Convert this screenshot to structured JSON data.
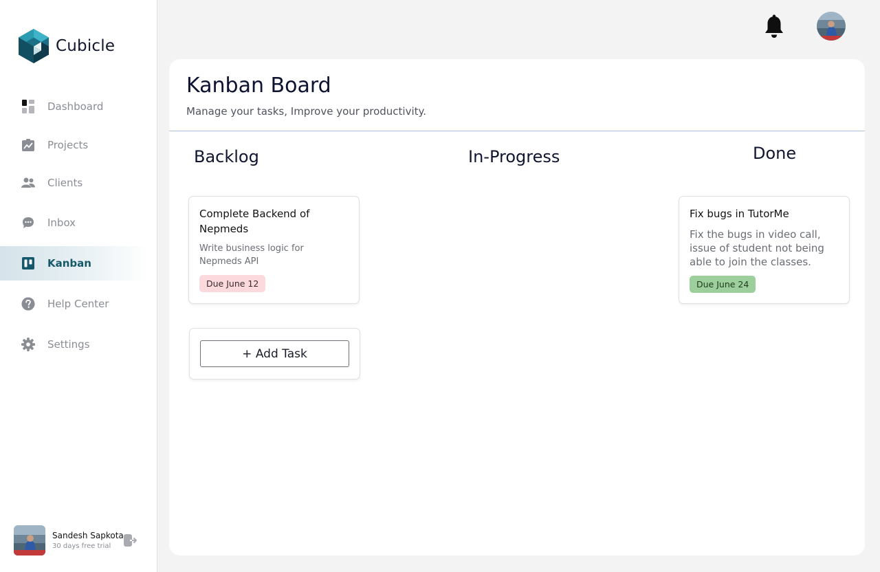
{
  "brand": {
    "name": "Cubicle"
  },
  "sidebar": {
    "items": [
      {
        "label": "Dashboard",
        "icon": "dashboard-icon",
        "active": false
      },
      {
        "label": "Projects",
        "icon": "projects-icon",
        "active": false
      },
      {
        "label": "Clients",
        "icon": "clients-icon",
        "active": false
      },
      {
        "label": "Inbox",
        "icon": "inbox-icon",
        "active": false
      },
      {
        "label": "Kanban",
        "icon": "kanban-icon",
        "active": true
      },
      {
        "label": "Help Center",
        "icon": "help-icon",
        "active": false
      },
      {
        "label": "Settings",
        "icon": "gear-icon",
        "active": false
      }
    ]
  },
  "user": {
    "name": "Sandesh Sapkota",
    "subtitle": "30 days free trial"
  },
  "header": {
    "title": "Kanban Board",
    "subtitle": "Manage your tasks, Improve your productivity."
  },
  "columns": {
    "backlog": {
      "title": "Backlog",
      "tasks": [
        {
          "title": "Complete Backend of Nepmeds",
          "description": "Write business logic for Nepmeds API",
          "due": "Due June 12",
          "badge_color": "#fbd9dc"
        }
      ],
      "add_label": "+ Add Task"
    },
    "in_progress": {
      "title": "In-Progress",
      "tasks": []
    },
    "done": {
      "title": "Done",
      "tasks": [
        {
          "title": "Fix bugs in TutorMe",
          "description": "Fix the bugs in video call, issue of student not being able to join the classes.",
          "due": "Due June 24",
          "badge_color": "#9ccf9c"
        }
      ]
    }
  },
  "colors": {
    "accent": "#16596b",
    "active_bg": "#d5e3ea",
    "logo_dark": "#16596b",
    "logo_light": "#2a9bb0"
  }
}
